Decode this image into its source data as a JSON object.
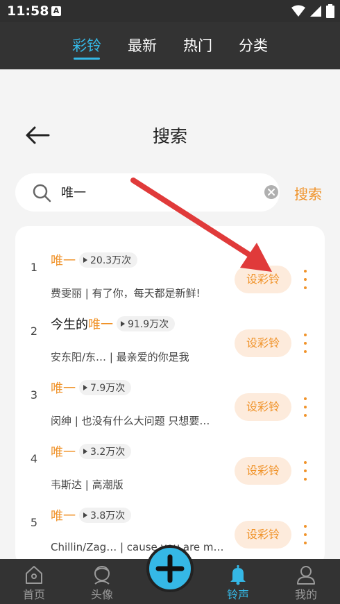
{
  "status_bar": {
    "time": "11:58",
    "notification_letter": "A"
  },
  "top_tabs": [
    {
      "label": "彩铃",
      "active": true
    },
    {
      "label": "最新",
      "active": false
    },
    {
      "label": "热门",
      "active": false
    },
    {
      "label": "分类",
      "active": false
    }
  ],
  "header": {
    "title": "搜索"
  },
  "search": {
    "value": "唯一",
    "button_label": "搜索"
  },
  "results": [
    {
      "rank": "1",
      "title_prefix": "",
      "title_highlight": "唯一",
      "plays": "20.3万次",
      "desc": "费雯丽 | 有了你，每天都是新鲜!",
      "action": "设彩铃"
    },
    {
      "rank": "2",
      "title_prefix": "今生的",
      "title_highlight": "唯一",
      "plays": "91.9万次",
      "desc": "安东阳/东…    | 最亲爱的你是我",
      "action": "设彩铃"
    },
    {
      "rank": "3",
      "title_prefix": "",
      "title_highlight": "唯一",
      "plays": "7.9万次",
      "desc": "闵绅 | 也没有什么大问题 只想要…",
      "action": "设彩铃"
    },
    {
      "rank": "4",
      "title_prefix": "",
      "title_highlight": "唯一",
      "plays": "3.2万次",
      "desc": "韦斯达 | 高潮版",
      "action": "设彩铃"
    },
    {
      "rank": "5",
      "title_prefix": "",
      "title_highlight": "唯一",
      "plays": "3.8万次",
      "desc": "Chillin/Zag…    | cause you are m…",
      "action": "设彩铃"
    }
  ],
  "bottom_nav": [
    {
      "label": "首页",
      "icon": "home-icon",
      "active": false
    },
    {
      "label": "头像",
      "icon": "avatar-icon",
      "active": false
    },
    {
      "label": "铃声",
      "icon": "bell-icon",
      "active": true
    },
    {
      "label": "我的",
      "icon": "profile-icon",
      "active": false
    }
  ],
  "colors": {
    "accent_orange": "#f0932a",
    "accent_blue": "#35b8e6",
    "annotation_red": "#e03a3a"
  }
}
